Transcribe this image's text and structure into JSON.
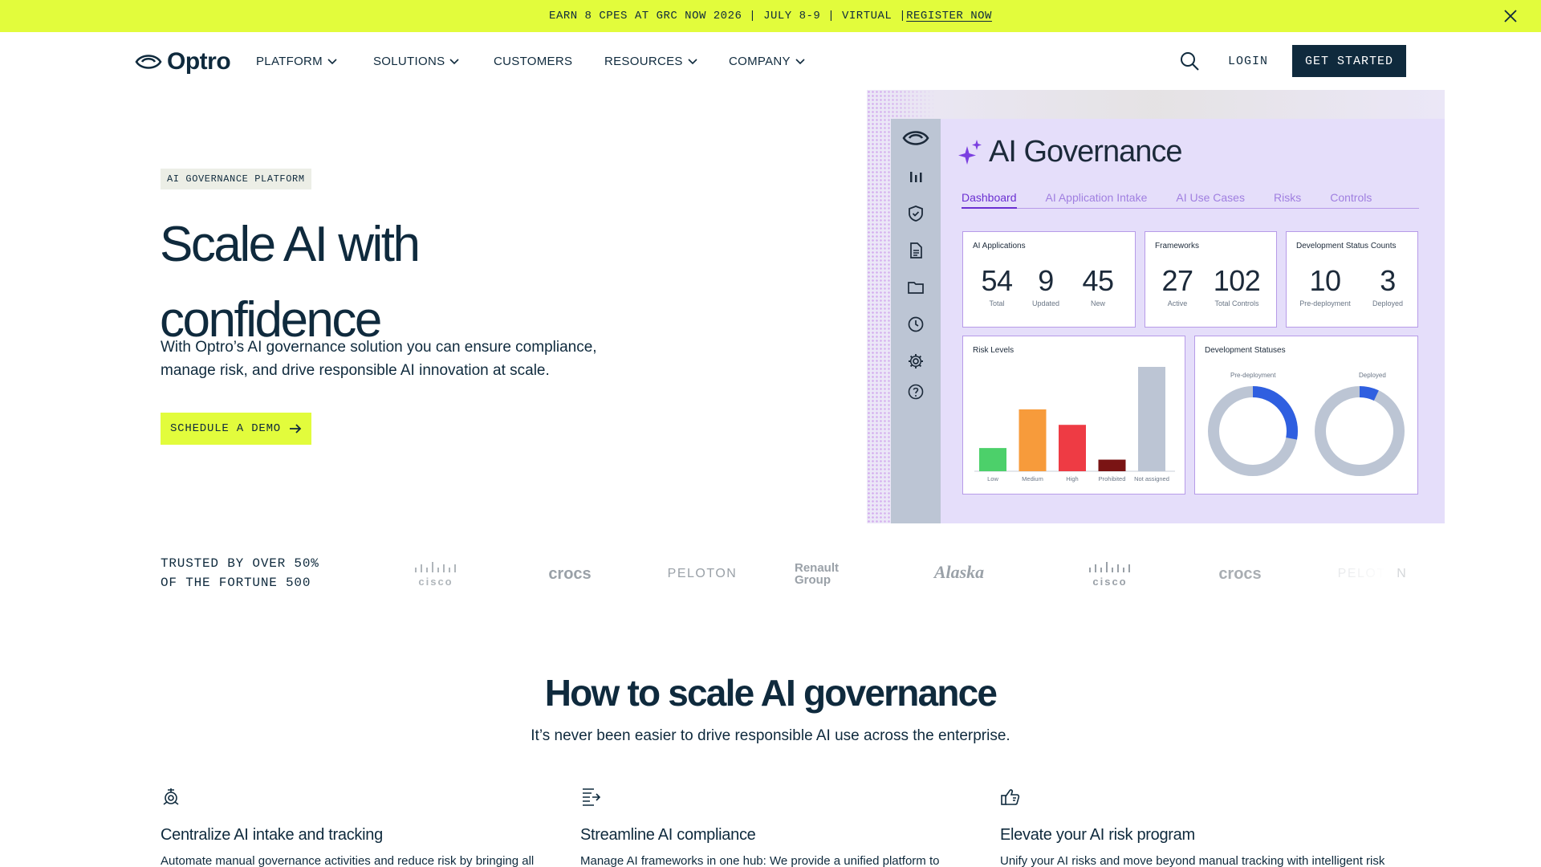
{
  "announcement": {
    "text": "EARN 8 CPES AT GRC NOW 2026 | JULY 8-9 | VIRTUAL | ",
    "link": "REGISTER NOW"
  },
  "nav": {
    "logo": "Optro",
    "items": [
      {
        "label": "PLATFORM",
        "dropdown": true
      },
      {
        "label": "SOLUTIONS",
        "dropdown": true
      },
      {
        "label": "CUSTOMERS",
        "dropdown": false
      },
      {
        "label": "RESOURCES",
        "dropdown": true
      },
      {
        "label": "COMPANY",
        "dropdown": true
      }
    ],
    "login": "LOGIN",
    "cta": "GET STARTED"
  },
  "hero": {
    "tag": "AI GOVERNANCE PLATFORM",
    "title_line1": "Scale AI with",
    "title_line2": "confidence",
    "description": "With Optro’s AI governance solution you can ensure compliance, manage risk, and drive responsible AI innovation at scale.",
    "cta": "SCHEDULE A DEMO"
  },
  "dashboard": {
    "title": "AI Governance",
    "tabs": [
      "Dashboard",
      "AI Application Intake",
      "AI Use Cases",
      "Risks",
      "Controls"
    ],
    "active_tab": "Dashboard",
    "cards": {
      "applications": {
        "title": "AI Applications",
        "stats": [
          {
            "num": "54",
            "label": "Total"
          },
          {
            "num": "9",
            "label": "Updated"
          },
          {
            "num": "45",
            "label": "New"
          }
        ]
      },
      "frameworks": {
        "title": "Frameworks",
        "stats": [
          {
            "num": "27",
            "label": "Active"
          },
          {
            "num": "102",
            "label": "Total Controls"
          }
        ]
      },
      "dev_counts": {
        "title": "Development Status Counts",
        "stats": [
          {
            "num": "10",
            "label": "Pre-deployment"
          },
          {
            "num": "3",
            "label": "Deployed"
          }
        ]
      }
    },
    "risk_card_title": "Risk Levels",
    "status_card_title": "Development Statuses",
    "donut_labels": [
      "Pre-deployment",
      "Deployed"
    ]
  },
  "chart_data": [
    {
      "type": "bar",
      "title": "Risk Levels",
      "categories": [
        "Low",
        "Medium",
        "High",
        "Prohibited",
        "Not assigned"
      ],
      "values": [
        3,
        8,
        6,
        1.5,
        13.5
      ],
      "colors": [
        "#4cd06a",
        "#f79b3b",
        "#ee3b44",
        "#7a1414",
        "#bcc5d4"
      ]
    },
    {
      "type": "pie",
      "title": "Development Statuses",
      "charts": [
        {
          "label": "Pre-deployment",
          "highlighted_fraction": 0.28
        },
        {
          "label": "Deployed",
          "highlighted_fraction": 0.07
        }
      ],
      "colors": {
        "highlight": "#2f5fe0",
        "rest": "#bcc5d4"
      }
    }
  ],
  "trusted": {
    "line1": "TRUSTED BY OVER 50%",
    "line2": "OF THE FORTUNE 500",
    "logos": [
      "cisco",
      "crocs",
      "PELOTON",
      "Renault Group",
      "Alaska",
      "cisco",
      "crocs",
      "PELOTON"
    ]
  },
  "how": {
    "title": "How to scale AI governance",
    "subtitle": "It’s never been easier to drive responsible AI use across the enterprise.",
    "features": [
      {
        "icon": "intake-icon",
        "title": "Centralize AI intake and tracking",
        "desc": "Automate manual governance activities and reduce risk by bringing all"
      },
      {
        "icon": "compliance-icon",
        "title": "Streamline AI compliance",
        "desc": "Manage AI frameworks in one hub: We provide a unified platform to"
      },
      {
        "icon": "thumbs-up-icon",
        "title": "Elevate your AI risk program",
        "desc": "Unify your AI risks and move beyond manual tracking with intelligent risk"
      }
    ]
  },
  "colors": {
    "accent": "#e2fc3c",
    "navy": "#0f2a3d",
    "purple": "#6a2fd1"
  }
}
